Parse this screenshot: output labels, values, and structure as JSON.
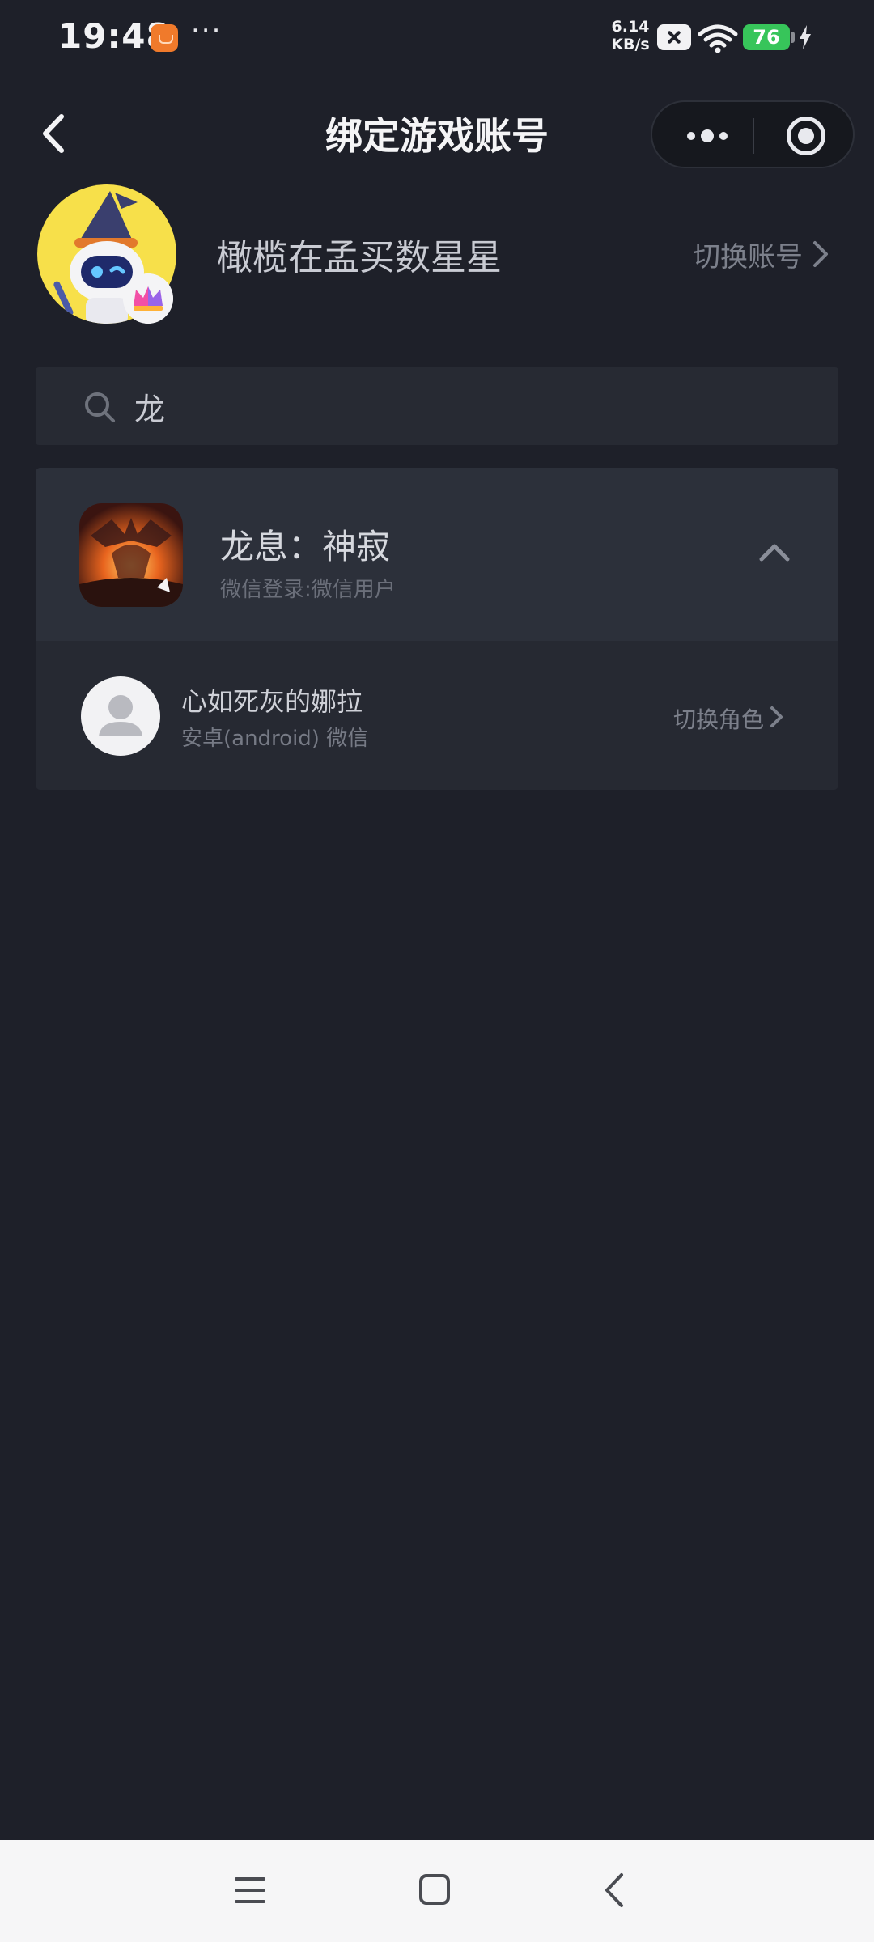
{
  "status_bar": {
    "time": "19:48",
    "more": "···",
    "speed_value": "6.14",
    "speed_unit": "KB/s",
    "battery": "76",
    "icons": [
      "app-notification-icon",
      "close-box-icon",
      "wifi-icon",
      "battery-icon",
      "charging-bolt-icon"
    ]
  },
  "nav": {
    "title": "绑定游戏账号",
    "icons": [
      "back-arrow-icon",
      "more-dots-icon",
      "target-circle-icon"
    ]
  },
  "profile": {
    "name": "橄榄在孟买数星星",
    "switch_label": "切换账号"
  },
  "search": {
    "value": "龙",
    "icon": "search-icon"
  },
  "game": {
    "name": "龙息：神寂",
    "login": "微信登录:微信用户",
    "expanded": true,
    "roles": [
      {
        "name": "心如死灰的娜拉",
        "platform": "安卓(android) 微信",
        "switch_label": "切换角色"
      }
    ]
  },
  "system_nav": {
    "icons": [
      "menu-icon",
      "home-icon",
      "back-icon"
    ]
  },
  "colors": {
    "background": "#1e2029",
    "card": "#262932",
    "card_header": "#2c303a",
    "battery": "#37c55a",
    "avatar_bg": "#f7e04a"
  }
}
